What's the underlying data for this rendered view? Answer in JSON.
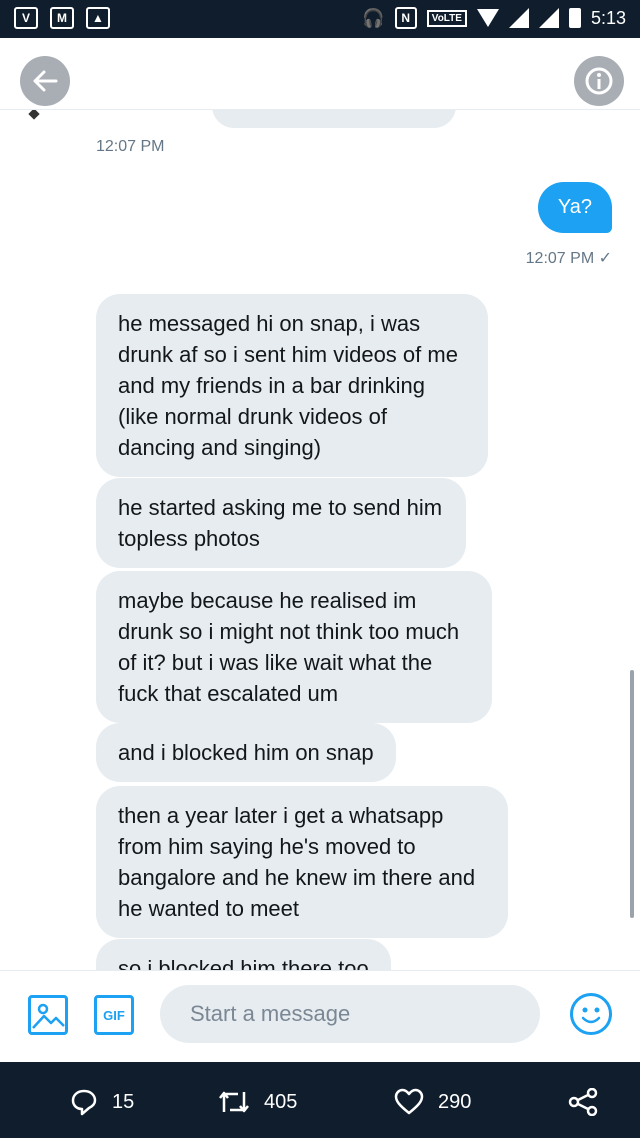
{
  "status_bar": {
    "time": "5:13",
    "volte": "VoLTE",
    "left_icons": [
      "app-icon",
      "gmail-icon",
      "gallery-icon"
    ],
    "right_icons": [
      "headset-icon",
      "nfc-icon",
      "wifi-icon",
      "signal-icon",
      "battery-icon"
    ]
  },
  "header": {
    "back_icon": "back-arrow-icon",
    "info_icon": "info-icon"
  },
  "conversation": {
    "timestamp_1": "12:07 PM",
    "sent_message": "Ya?",
    "timestamp_2": "12:07 PM ✓",
    "received_messages": [
      "he messaged hi on snap, i was drunk af so i sent him videos of me and my friends in a bar drinking (like normal drunk videos of dancing and singing)",
      "he started asking me to send him topless photos",
      "maybe because he realised im drunk so i might not think too much of it? but i was like wait what the fuck that escalated um",
      "and i blocked him on snap",
      "then a year later i get a whatsapp from him saying he's moved to bangalore and he knew im there and he wanted to meet",
      "so i blocked him there too"
    ]
  },
  "composer": {
    "gif_label": "GIF",
    "placeholder": "Start a message"
  },
  "tweet_actions": {
    "replies": "15",
    "retweets": "405",
    "likes": "290"
  },
  "colors": {
    "accent": "#1da1f2",
    "bubble_gray": "#e6ecf0",
    "dark_bar": "#0f1d2c"
  }
}
